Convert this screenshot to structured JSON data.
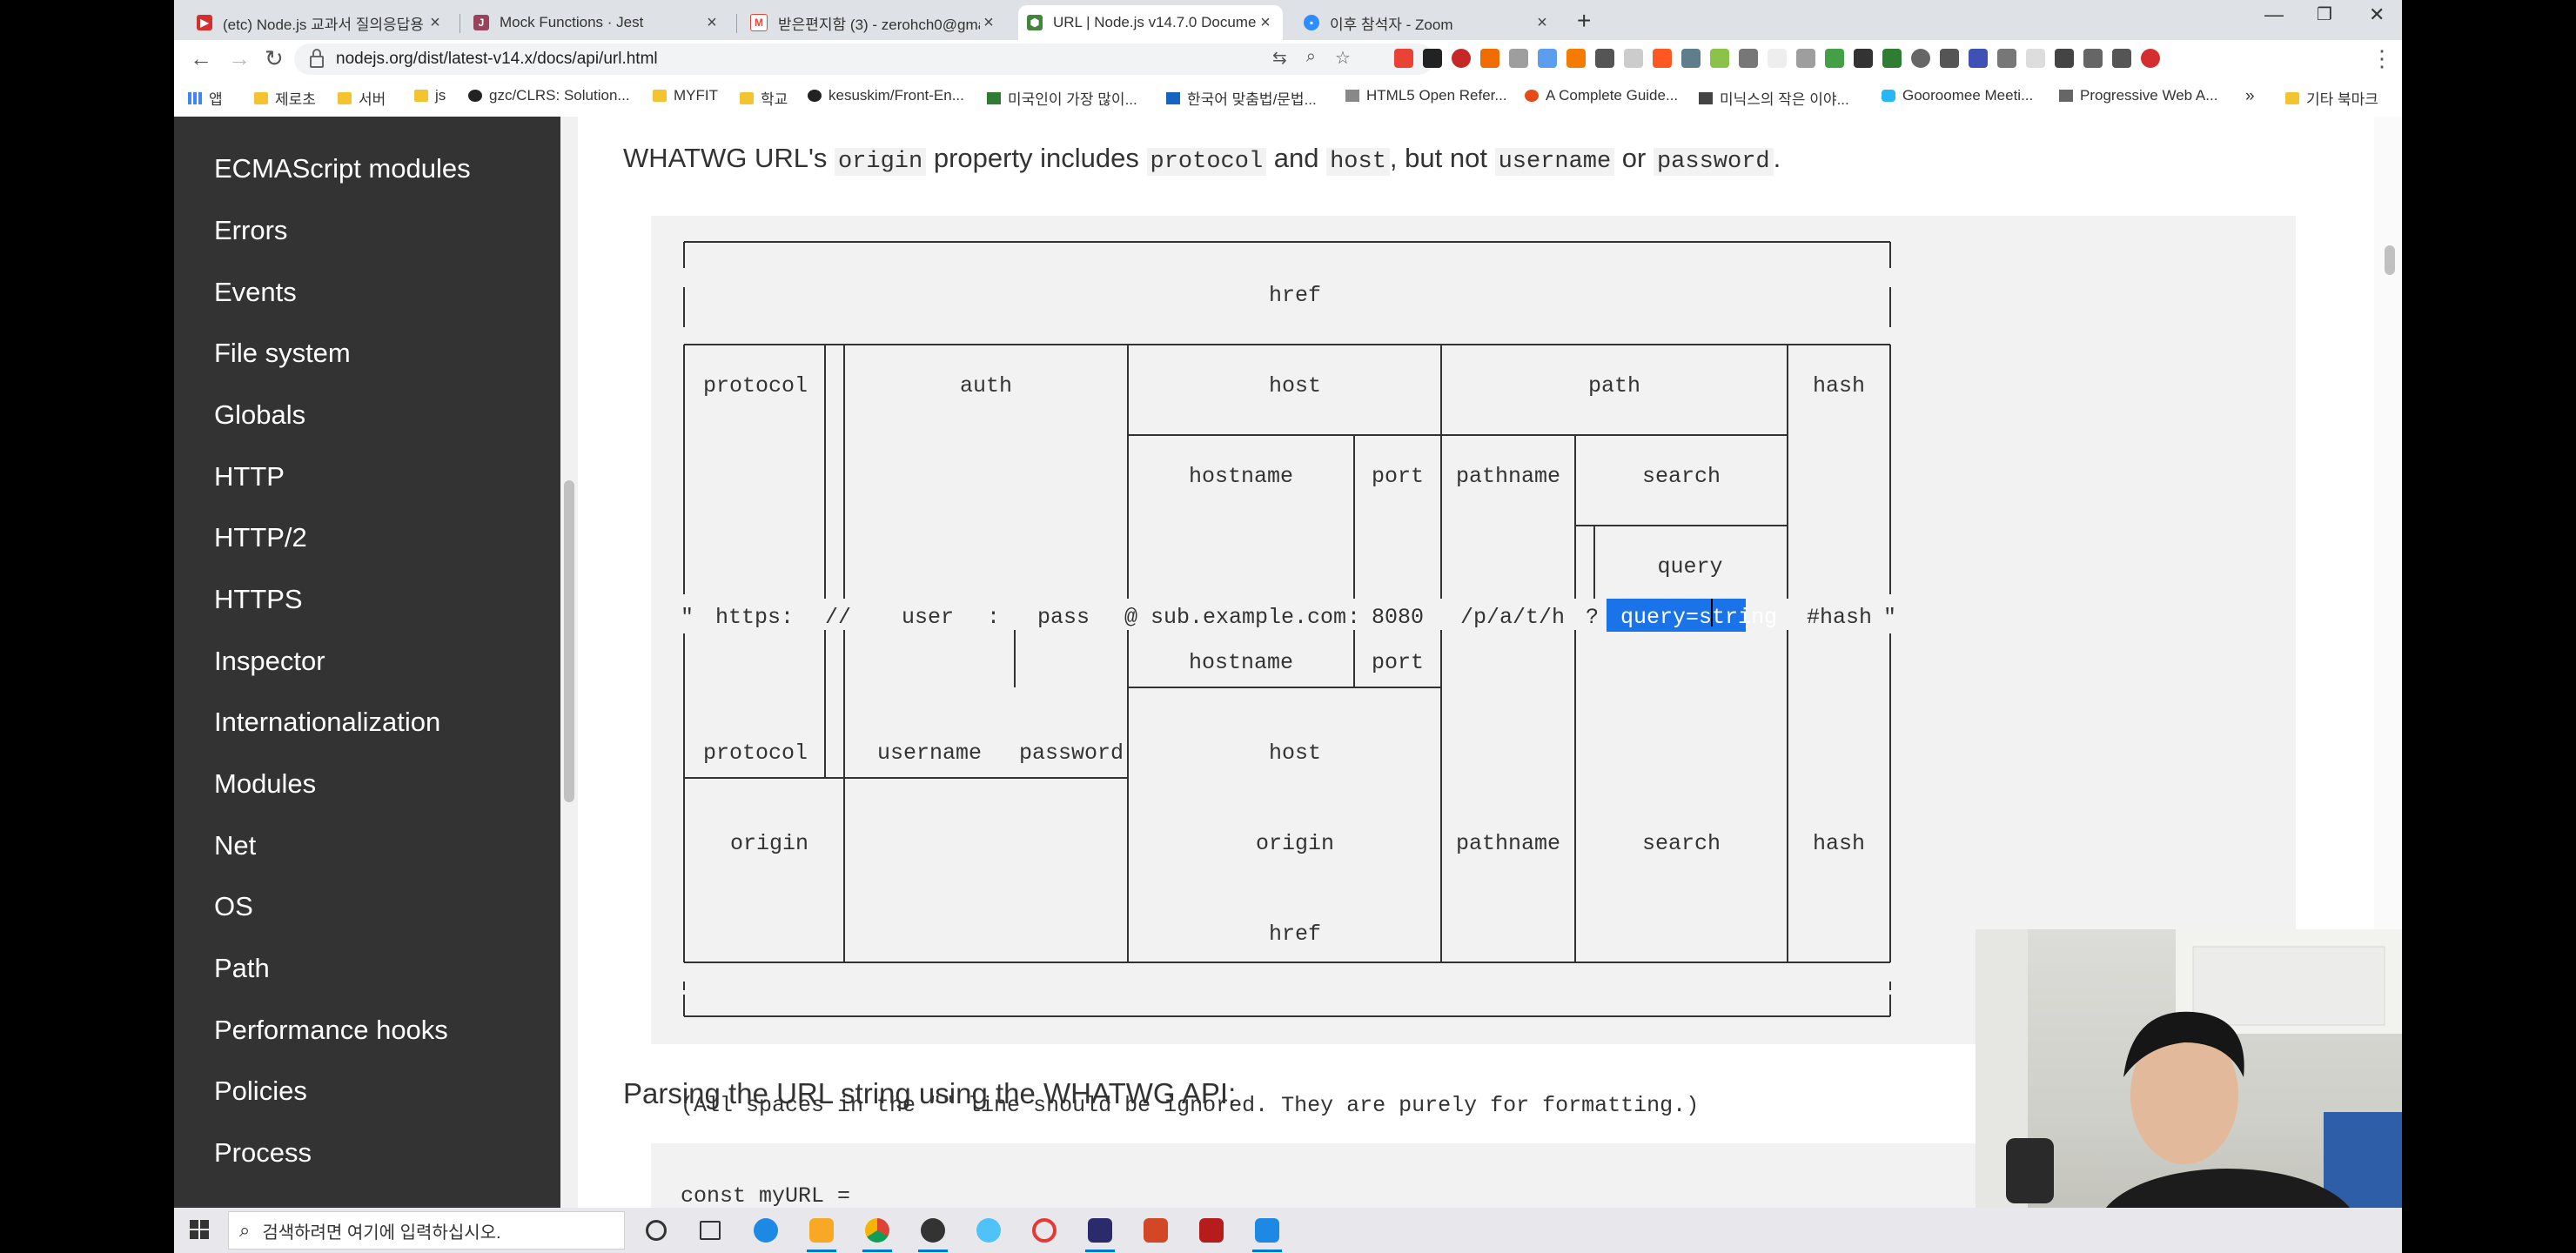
{
  "browser": {
    "tabs": [
      {
        "label": "(etc) Node.js 교과서 질의응답용",
        "icon": "youtube-icon",
        "color": "#d32f2f"
      },
      {
        "label": "Mock Functions · Jest",
        "icon": "jest-icon",
        "color": "#99425b"
      },
      {
        "label": "받은편지함 (3) - zerohch0@gma",
        "icon": "gmail-icon",
        "color": "#ea4335"
      },
      {
        "label": "URL | Node.js v14.7.0 Documen",
        "icon": "nodejs-icon",
        "color": "#43853d"
      },
      {
        "label": "이후 참석자 - Zoom",
        "icon": "zoom-icon",
        "color": "#2d8cff"
      }
    ],
    "url": "nodejs.org/dist/latest-v14.x/docs/api/url.html",
    "bookmarks": [
      {
        "label": "앱",
        "icon": "apps-icon"
      },
      {
        "label": "제로초",
        "icon": "folder-icon"
      },
      {
        "label": "서버",
        "icon": "folder-icon"
      },
      {
        "label": "js",
        "icon": "folder-icon"
      },
      {
        "label": "gzc/CLRS: Solution...",
        "icon": "github-icon"
      },
      {
        "label": "MYFIT",
        "icon": "folder-icon"
      },
      {
        "label": "학교",
        "icon": "folder-icon"
      },
      {
        "label": "kesuskim/Front-En...",
        "icon": "github-icon"
      },
      {
        "label": "미국인이 가장 많이...",
        "icon": "bookmark-icon"
      },
      {
        "label": "한국어 맞춤법/문법...",
        "icon": "bookmark-icon"
      },
      {
        "label": "HTML5 Open Refer...",
        "icon": "bookmark-icon"
      },
      {
        "label": "A Complete Guide...",
        "icon": "bookmark-icon"
      },
      {
        "label": "미닉스의 작은 이야...",
        "icon": "bookmark-icon"
      },
      {
        "label": "Gooroomee Meeti...",
        "icon": "bookmark-icon"
      },
      {
        "label": "Progressive Web A...",
        "icon": "bookmark-icon"
      },
      {
        "label": "»",
        "icon": "more-icon"
      },
      {
        "label": "기타 북마크",
        "icon": "folder-icon"
      }
    ]
  },
  "sidebar": {
    "items": [
      "ECMAScript modules",
      "Errors",
      "Events",
      "File system",
      "Globals",
      "HTTP",
      "HTTP/2",
      "HTTPS",
      "Inspector",
      "Internationalization",
      "Modules",
      "Net",
      "OS",
      "Path",
      "Performance hooks",
      "Policies",
      "Process"
    ]
  },
  "content": {
    "intro": {
      "t1": "WHATWG URL's ",
      "c1": "origin",
      "t2": " property includes ",
      "c2": "protocol",
      "t3": " and ",
      "c3": "host",
      "t4": ", but not ",
      "c4": "username",
      "t5": " or ",
      "c5": "password",
      "t6": "."
    },
    "diagram": {
      "href": "href",
      "protocol": "protocol",
      "auth": "auth",
      "host": "host",
      "path": "path",
      "hash": "hash",
      "hostname": "hostname",
      "port": "port",
      "pathname": "pathname",
      "search": "search",
      "query": "query",
      "url_quote_open": "\"",
      "url_https": "https:",
      "url_slashes": "//",
      "url_user": "user",
      "url_colon1": ":",
      "url_pass": "pass",
      "url_at": "@",
      "url_host": "sub.example.com",
      "url_colon2": ":",
      "url_port": "8080",
      "url_path": "/p/a/t/h",
      "url_qmark": "?",
      "url_query": "query=string",
      "url_hash": "#hash",
      "url_quote_close": "\"",
      "username": "username",
      "password": "password",
      "origin": "origin"
    },
    "note": "(All spaces in the \"\" line should be ignored. They are purely for formatting.)",
    "parsing_heading": "Parsing the URL string using the WHATWG API:",
    "code": "const myURL ="
  },
  "taskbar": {
    "search_placeholder": "검색하려면 여기에 입력하십시오."
  },
  "colors": {
    "sidebar_bg": "#333333",
    "selection": "#1a73e8",
    "code_bg": "#f2f2f2"
  }
}
